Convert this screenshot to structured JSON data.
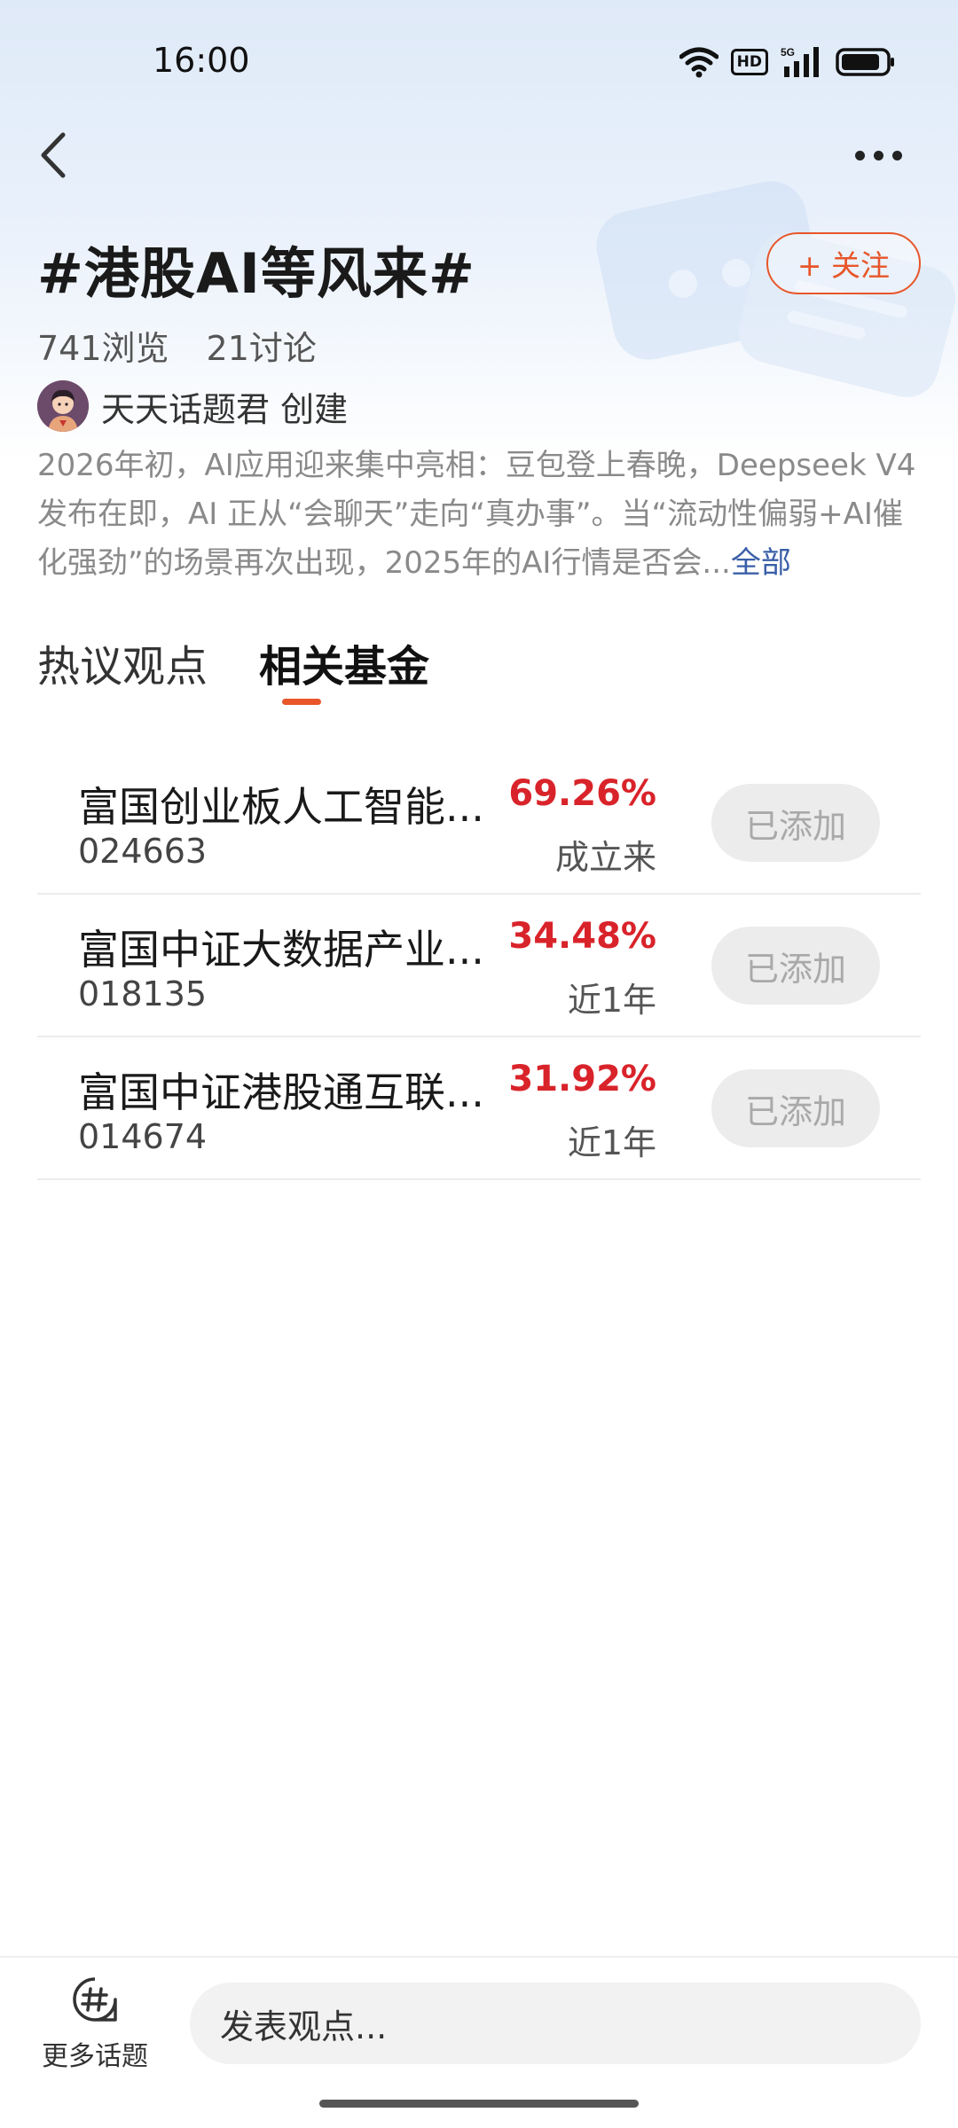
{
  "status_bar": {
    "time": "16:00",
    "icons": [
      "wifi-icon",
      "hd-badge",
      "signal-5g-icon",
      "battery-icon"
    ],
    "hd_label": "HD",
    "network_label": "5G"
  },
  "nav": {
    "back_icon": "chevron-left-icon",
    "more_icon": "more-horizontal-icon"
  },
  "topic": {
    "title": "#港股AI等风来#",
    "follow_label": "+ 关注",
    "views": "741浏览",
    "discussions": "21讨论",
    "creator_name": "天天话题君 创建",
    "description": "2026年初，AI应用迎来集中亮相：豆包登上春晚，Deepseek V4发布在即，AI 正从“会聊天”走向“真办事”。当“流动性偏弱+AI催化强劲”的场景再次出现，2025年的AI行情是否会...",
    "description_more": "全部"
  },
  "tabs": [
    {
      "label": "热议观点",
      "active": false
    },
    {
      "label": "相关基金",
      "active": true
    }
  ],
  "funds": [
    {
      "name": "富国创业板人工智能...",
      "code": "024663",
      "return": "69.26%",
      "period": "成立来",
      "action": "已添加"
    },
    {
      "name": "富国中证大数据产业...",
      "code": "018135",
      "return": "34.48%",
      "period": "近1年",
      "action": "已添加"
    },
    {
      "name": "富国中证港股通互联...",
      "code": "014674",
      "return": "31.92%",
      "period": "近1年",
      "action": "已添加"
    }
  ],
  "bottom_bar": {
    "more_topics_icon": "hashtag-icon",
    "more_topics_label": "更多话题",
    "comment_placeholder": "发表观点..."
  },
  "colors": {
    "accent": "#e8562a",
    "positive_return": "#d9232a",
    "link": "#3a5fa8"
  }
}
